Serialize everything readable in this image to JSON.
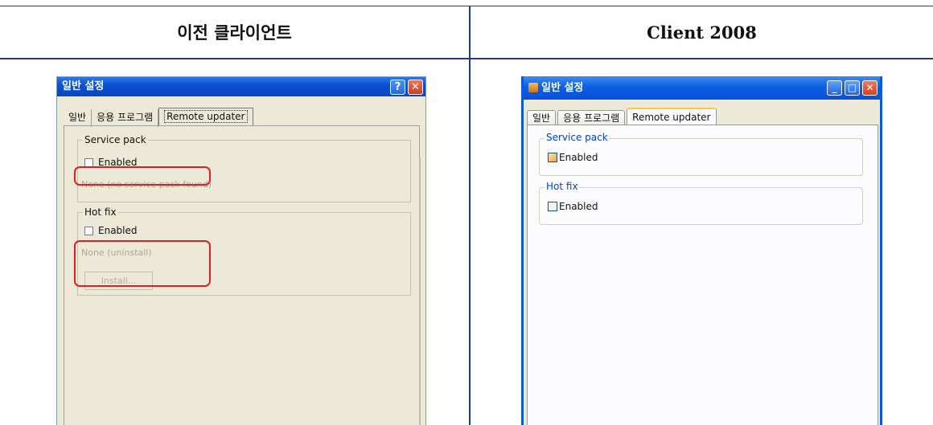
{
  "header": {
    "left_label": "이전 클라이언트",
    "right_label": "Client 2008"
  },
  "old_client": {
    "title": "일반 설정",
    "help_glyph": "?",
    "close_glyph": "✕",
    "tabs": [
      "일반",
      "응용 프로그램",
      "Remote updater"
    ],
    "active_tab": "Remote updater",
    "service_pack": {
      "legend": "Service pack",
      "checkbox_label": "Enabled",
      "checked": false,
      "status_text": "None (no service pack found)"
    },
    "hot_fix": {
      "legend": "Hot fix",
      "checkbox_label": "Enabled",
      "checked": false,
      "status_text": "None (uninstall)",
      "install_button": "Install..."
    },
    "highlight_color": "#e02020"
  },
  "new_client": {
    "title": "일반 설정",
    "min_glyph": "_",
    "max_glyph": "□",
    "close_glyph": "✕",
    "tabs": [
      "일반",
      "응용 프로그램",
      "Remote updater"
    ],
    "active_tab": "Remote updater",
    "service_pack": {
      "legend": "Service pack",
      "checkbox_label": "Enabled",
      "checked": false
    },
    "hot_fix": {
      "legend": "Hot fix",
      "checkbox_label": "Enabled",
      "checked": false
    },
    "accent_color": "#0b5bd8"
  }
}
